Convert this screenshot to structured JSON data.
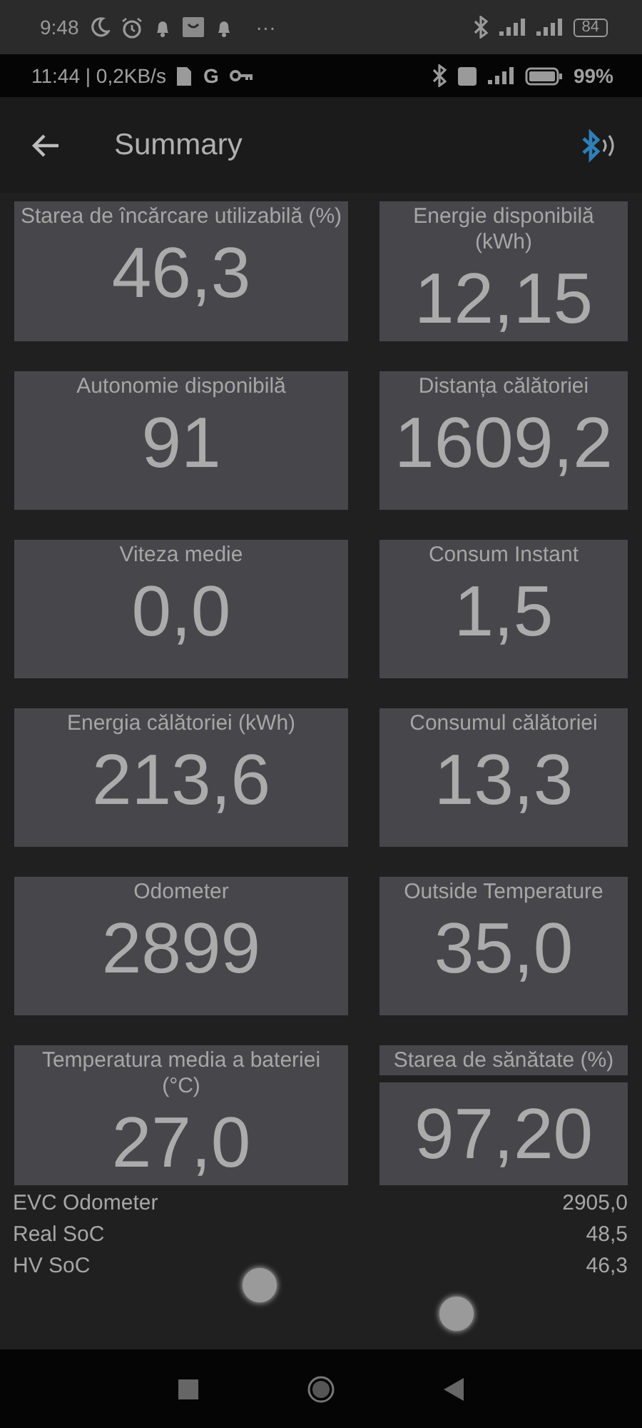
{
  "system_status": {
    "time": "9:48",
    "more": "···",
    "battery": "84"
  },
  "app_status": {
    "clock_speed": "11:44 | 0,2KB/s",
    "network": "G",
    "battery": "99%"
  },
  "app_bar": {
    "title": "Summary"
  },
  "tiles": [
    {
      "label": "Starea de încărcare utilizabilă (%)",
      "value": "46,3",
      "kind": "joined"
    },
    {
      "label": "Energie disponibilă (kWh)",
      "value": "12,15",
      "kind": "joined"
    },
    {
      "label": "Autonomie disponibilă",
      "value": "91",
      "kind": "joined"
    },
    {
      "label": "Distanța călătoriei",
      "value": "1609,2",
      "kind": "joined"
    },
    {
      "label": "Viteza medie",
      "value": "0,0",
      "kind": "joined"
    },
    {
      "label": "Consum Instant",
      "value": "1,5",
      "kind": "joined"
    },
    {
      "label": "Energia călătoriei (kWh)",
      "value": "213,6",
      "kind": "joined"
    },
    {
      "label": "Consumul călătoriei",
      "value": "13,3",
      "kind": "joined"
    },
    {
      "label": "Odometer",
      "value": "2899",
      "kind": "joined"
    },
    {
      "label": "Outside Temperature",
      "value": "35,0",
      "kind": "joined"
    },
    {
      "label": "Temperatura media a bateriei (°C)",
      "value": "27,0",
      "kind": "joined"
    },
    {
      "label": "Starea de sănătate (%)",
      "value": "97,20",
      "kind": "split"
    }
  ],
  "info_rows": [
    {
      "label": "EVC Odometer",
      "value": "2905,0"
    },
    {
      "label": "Real SoC",
      "value": "48,5"
    },
    {
      "label": "HV SoC",
      "value": "46,3"
    }
  ]
}
